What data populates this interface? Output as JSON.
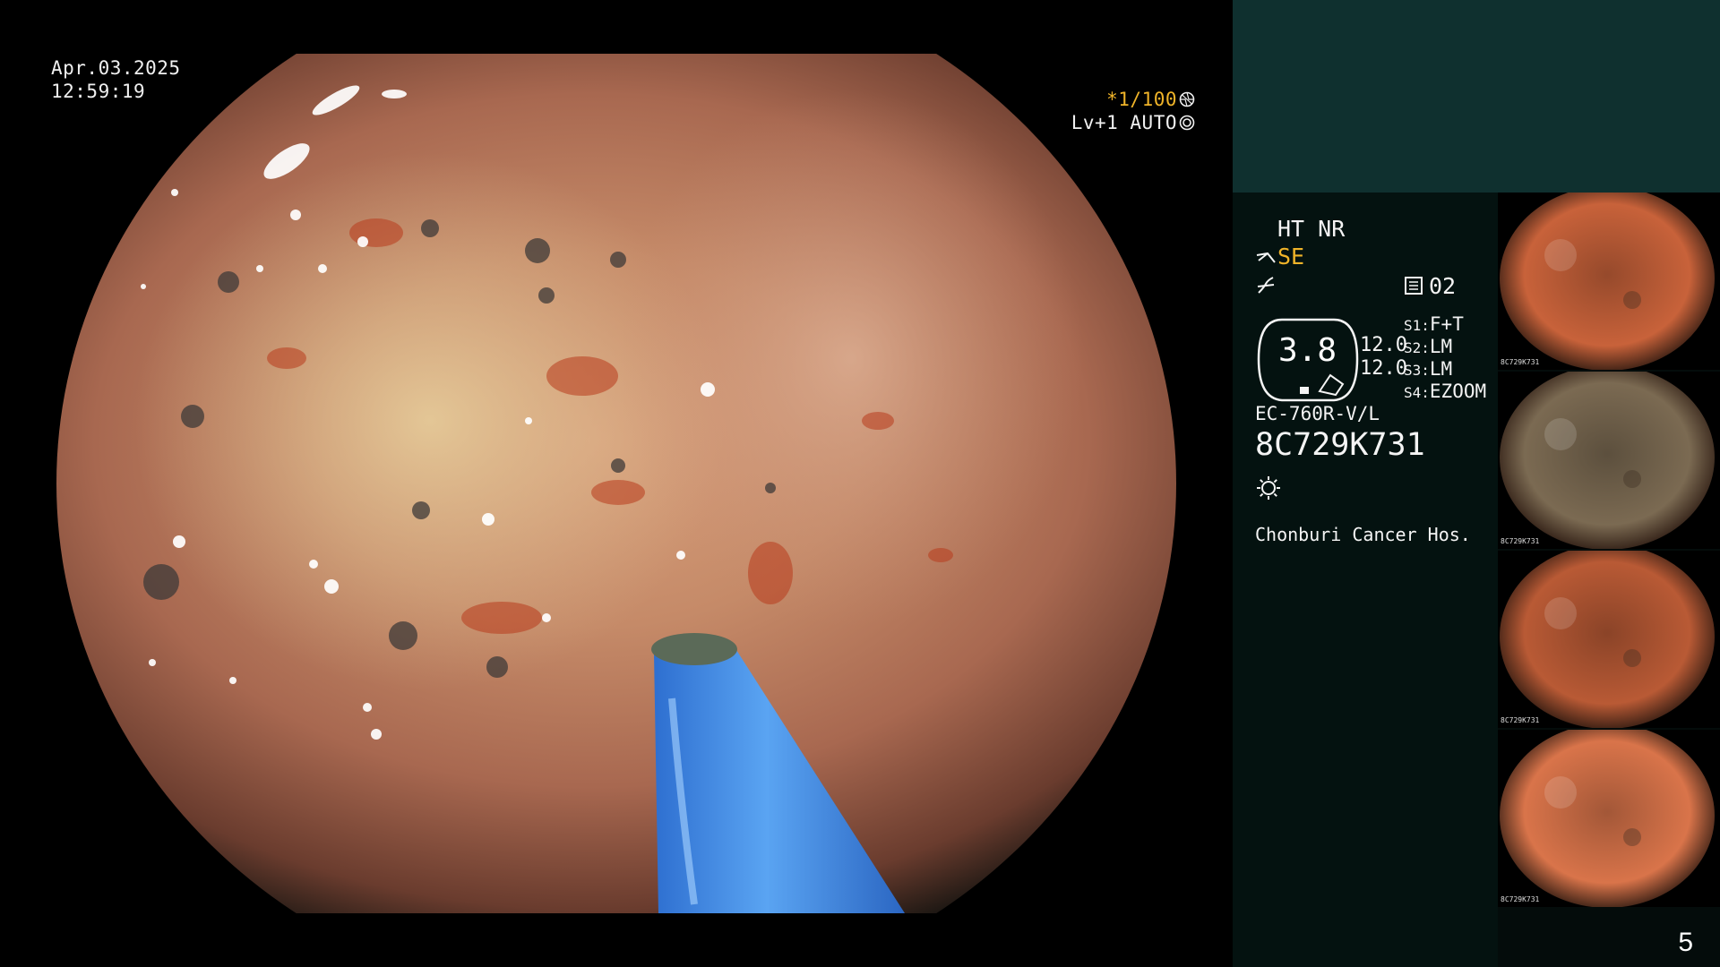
{
  "osd": {
    "date": "Apr.03.2025",
    "time": "12:59:19",
    "shutter": "*1/100",
    "enhance": "Lv+1 AUTO"
  },
  "panel": {
    "ht_nr": "HT NR",
    "se_label": "SE",
    "memo_number": "02",
    "gauge_value": "3.8",
    "aperture_1": "12.0",
    "aperture_2": "12.0",
    "s1_label": "S1:",
    "s1_value": "F+T",
    "s2_label": "S2:",
    "s2_value": "LM",
    "s3_label": "S3:",
    "s3_value": "LM",
    "s4_label": "S4:",
    "s4_value": "EZOOM",
    "scope_model": "EC-760R-V/L",
    "serial_number": "8C729K731",
    "hospital": "Chonburi Cancer Hos."
  },
  "thumbnails": [
    {
      "serial": "8C729K731",
      "tone": "#c8623a"
    },
    {
      "serial": "8C729K731",
      "tone": "#7b6a52"
    },
    {
      "serial": "8C729K731",
      "tone": "#b95a35"
    },
    {
      "serial": "8C729K731",
      "tone": "#d9744a"
    }
  ],
  "page_number": "5",
  "colors": {
    "panel_top": "#0f302f",
    "panel_bg": "#041210",
    "accent_yellow": "#f0b429",
    "device_blue": "#3f8fe6"
  },
  "icons": [
    "shutter-icon",
    "enhance-icon",
    "pen-icon",
    "freeze-icon",
    "memo-icon",
    "light-icon"
  ]
}
